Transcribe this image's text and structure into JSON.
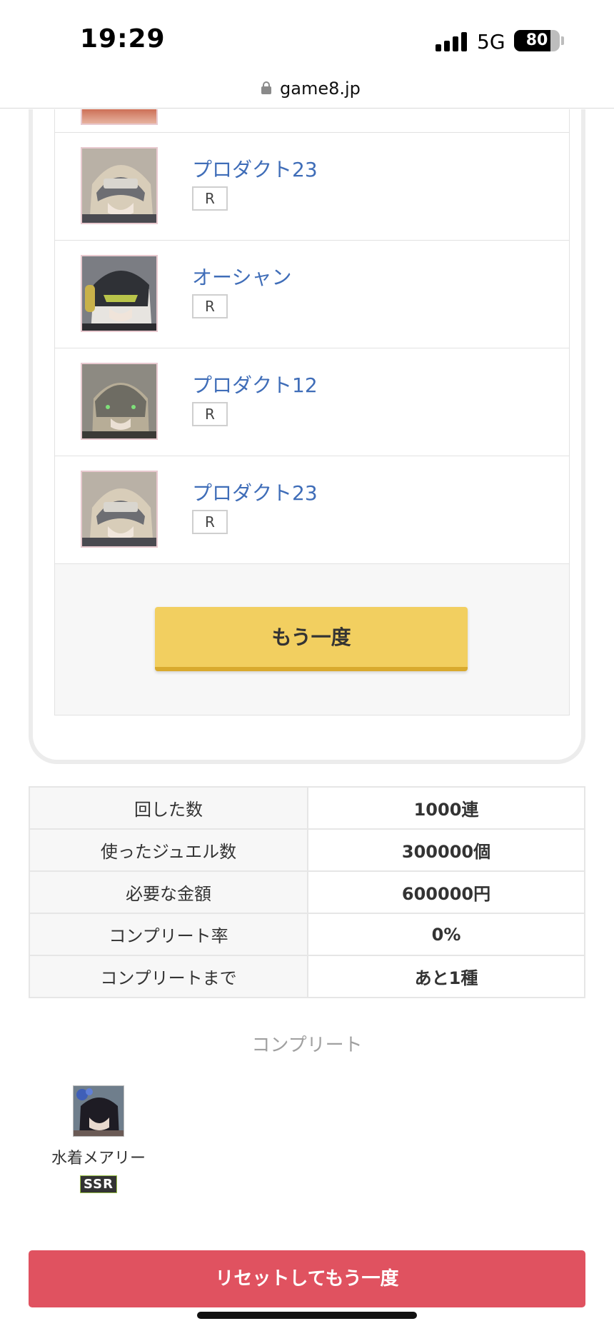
{
  "status_bar": {
    "time": "19:29",
    "network": "5G",
    "battery_percent": 80,
    "battery_label": "80"
  },
  "browser": {
    "url": "game8.jp"
  },
  "results": [
    {
      "name": "プロダクト23",
      "rarity": "R"
    },
    {
      "name": "オーシャン",
      "rarity": "R"
    },
    {
      "name": "プロダクト12",
      "rarity": "R"
    },
    {
      "name": "プロダクト23",
      "rarity": "R"
    }
  ],
  "again_button": "もう一度",
  "stats": [
    {
      "label": "回した数",
      "value": "1000連"
    },
    {
      "label": "使ったジュエル数",
      "value": "300000個"
    },
    {
      "label": "必要な金額",
      "value": "600000円"
    },
    {
      "label": "コンプリート率",
      "value": "0%"
    },
    {
      "label": "コンプリートまで",
      "value": "あと1種"
    }
  ],
  "complete": {
    "heading": "コンプリート",
    "items": [
      {
        "name": "水着メアリー",
        "rarity": "SSR"
      }
    ]
  },
  "reset_button": "リセットしてもう一度"
}
